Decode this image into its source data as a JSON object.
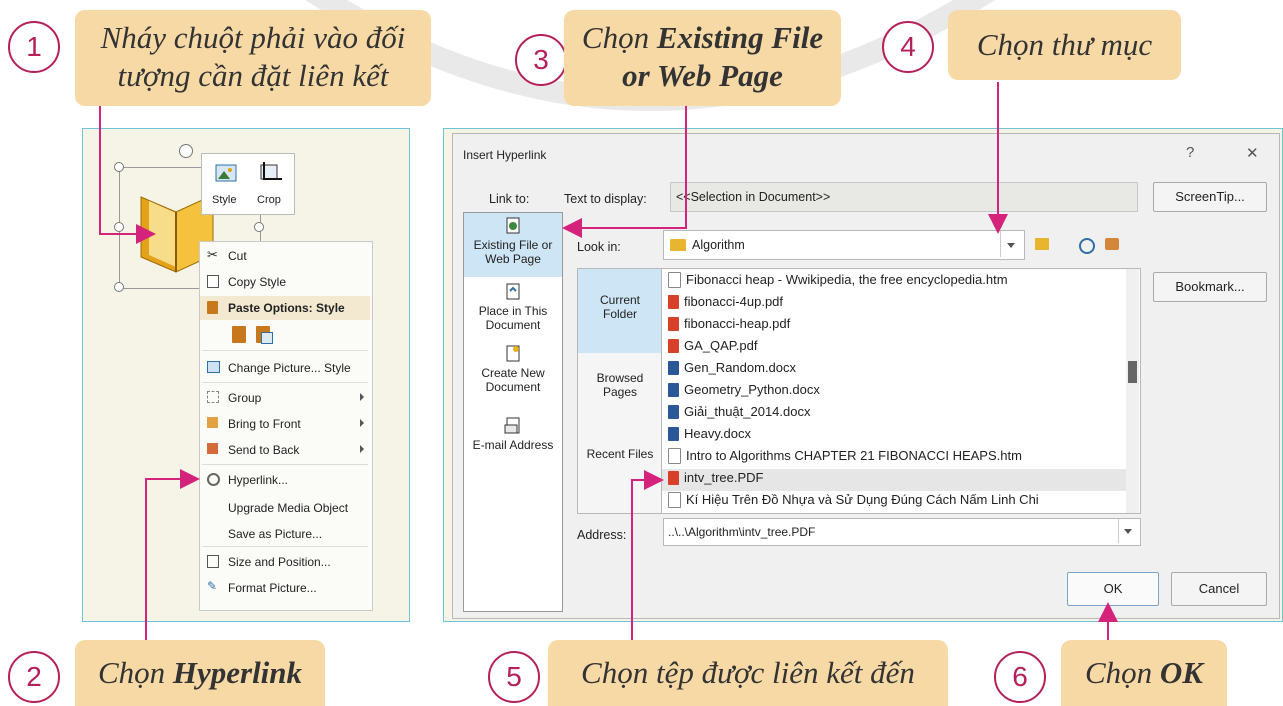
{
  "steps": [
    {
      "num": "1",
      "text_line1": "Nháy chuột phải vào đối",
      "text_line2": "tượng cần đặt liên kết"
    },
    {
      "num": "2",
      "prefix": "Chọn ",
      "bold": "Hyperlink"
    },
    {
      "num": "3",
      "prefix": "Chọn ",
      "bold": "Existing File",
      "bold_line2": "or Web Page"
    },
    {
      "num": "4",
      "text": "Chọn thư mục"
    },
    {
      "num": "5",
      "text": "Chọn tệp được liên kết đến"
    },
    {
      "num": "6",
      "prefix": "Chọn ",
      "bold": "OK"
    }
  ],
  "minitoolbar": {
    "style_label": "Style",
    "crop_label": "Crop"
  },
  "context_menu": {
    "items": [
      {
        "label": "Cut",
        "icon": "scissors-icon"
      },
      {
        "label": "Copy  Style",
        "icon": "copy-icon"
      },
      {
        "label": "Paste Options: Style",
        "icon": "paste-icon"
      },
      {
        "label": "Change Picture...  Style",
        "icon": "change-picture-icon"
      },
      {
        "label": "Group",
        "icon": "group-icon",
        "submenu": true
      },
      {
        "label": "Bring to Front",
        "icon": "bring-front-icon",
        "submenu": true
      },
      {
        "label": "Send to Back",
        "icon": "send-back-icon",
        "submenu": true
      },
      {
        "label": "Hyperlink...",
        "icon": "hyperlink-icon"
      },
      {
        "label": "Upgrade Media Object",
        "icon": ""
      },
      {
        "label": "Save as Picture...",
        "icon": ""
      },
      {
        "label": "Size and Position...",
        "icon": "size-position-icon"
      },
      {
        "label": "Format Picture...",
        "icon": "format-picture-icon"
      }
    ]
  },
  "dialog": {
    "title": "Insert Hyperlink",
    "help": "?",
    "close": "✕",
    "link_to_label": "Link to:",
    "text_to_display_label": "Text to display:",
    "text_to_display_value": "<<Selection in Document>>",
    "screentip_label": "ScreenTip...",
    "look_in_label": "Look in:",
    "look_in_value": "Algorithm",
    "bookmark_label": "Bookmark...",
    "address_label": "Address:",
    "address_value": "..\\..\\Algorithm\\intv_tree.PDF",
    "ok_label": "OK",
    "cancel_label": "Cancel",
    "link_targets": [
      {
        "label_line1": "Existing File or",
        "label_line2": "Web Page"
      },
      {
        "label_line1": "Place in This",
        "label_line2": "Document"
      },
      {
        "label_line1": "Create New",
        "label_line2": "Document"
      },
      {
        "label_line1": "E-mail Address",
        "label_line2": ""
      }
    ],
    "browse_sections": [
      {
        "line1": "Current",
        "line2": "Folder"
      },
      {
        "line1": "Browsed",
        "line2": "Pages"
      },
      {
        "line1": "Recent Files",
        "line2": ""
      }
    ],
    "files": [
      {
        "name": "Fibonacci heap - Wwikipedia, the free encyclopedia.htm",
        "type": "htm"
      },
      {
        "name": "fibonacci-4up.pdf",
        "type": "pdf"
      },
      {
        "name": "fibonacci-heap.pdf",
        "type": "pdf"
      },
      {
        "name": "GA_QAP.pdf",
        "type": "pdf"
      },
      {
        "name": "Gen_Random.docx",
        "type": "docx"
      },
      {
        "name": "Geometry_Python.docx",
        "type": "docx"
      },
      {
        "name": "Giải_thuật_2014.docx",
        "type": "docx"
      },
      {
        "name": "Heavy.docx",
        "type": "docx"
      },
      {
        "name": "Intro to Algorithms  CHAPTER 21  FIBONACCI HEAPS.htm",
        "type": "htm"
      },
      {
        "name": "intv_tree.PDF",
        "type": "pdf"
      },
      {
        "name": "Kí Hiệu Trên Đồ Nhựa và Sử Dụng Đúng Cách Nấm Linh Chi",
        "type": "htm"
      }
    ]
  }
}
